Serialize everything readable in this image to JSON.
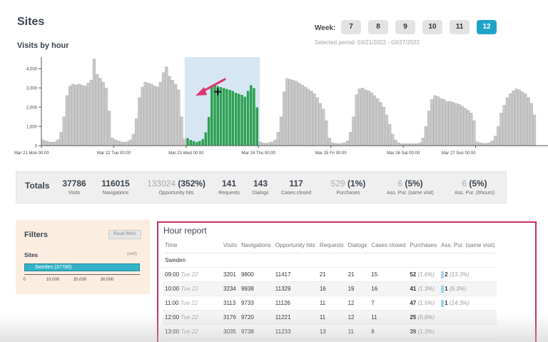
{
  "page": {
    "title": "Sites"
  },
  "week_selector": {
    "label": "Week:",
    "weeks": [
      "7",
      "8",
      "9",
      "10",
      "11",
      "12"
    ],
    "active": "12",
    "selected_period": "Selected period: 03/21/2022 - 03/27/2022"
  },
  "chart_data": {
    "type": "bar",
    "title": "Visits by hour",
    "yticks": [
      "0",
      "1,000",
      "2,000",
      "3,000",
      "4,000"
    ],
    "ylim": [
      0,
      4600
    ],
    "xticks": [
      "Mar 21 Mon 00:00",
      "Mar 22 Tue 00:00",
      "Mar 23 Wed 00:00",
      "Mar 24 Thu 00:00",
      "Mar 25 Fri 00:00",
      "Mar 26 Sat 00:00",
      "Mar 27 Sun 00:00"
    ],
    "hours_per_bar": 1,
    "selected_range_hours": [
      48,
      72
    ],
    "colors": {
      "bar": "#c8c8c8",
      "bar_stroke": "#9a9a9a",
      "selected": "#2da055",
      "selection_bg": "#d7e6f3"
    },
    "values": [
      300,
      250,
      200,
      180,
      200,
      300,
      700,
      1500,
      2600,
      3100,
      3200,
      3150,
      3200,
      3150,
      3100,
      3250,
      3400,
      4500,
      3700,
      3500,
      3300,
      3000,
      1800,
      400,
      300,
      250,
      200,
      180,
      200,
      300,
      600,
      1400,
      2500,
      3050,
      3300,
      3250,
      3200,
      3100,
      3050,
      3300,
      3800,
      4100,
      3600,
      3400,
      3200,
      2900,
      1500,
      350,
      400,
      300,
      250,
      200,
      250,
      350,
      700,
      1500,
      3050,
      3150,
      3100,
      3050,
      3000,
      2950,
      2900,
      2850,
      2750,
      2700,
      2650,
      2550,
      2850,
      3150,
      3000,
      2000,
      200,
      150,
      120,
      150,
      200,
      300,
      700,
      1500,
      2800,
      3500,
      3450,
      3400,
      3350,
      3250,
      3150,
      3050,
      2950,
      2850,
      2700,
      2500,
      2200,
      1900,
      1300,
      400,
      150,
      120,
      100,
      120,
      150,
      250,
      700,
      1500,
      2650,
      2950,
      3000,
      2900,
      2850,
      2750,
      2600,
      2450,
      2250,
      2000,
      1600,
      1100,
      600,
      300,
      150,
      100,
      100,
      100,
      100,
      100,
      100,
      150,
      400,
      1000,
      1800,
      2400,
      2600,
      2550,
      2450,
      2400,
      2300,
      2300,
      2250,
      2200,
      2150,
      2050,
      1950,
      1850,
      1700,
      1300,
      200,
      150,
      120,
      120,
      150,
      250,
      500,
      1000,
      1700,
      2100,
      2500,
      2700,
      2850,
      2950,
      2900,
      2800,
      2700,
      2500,
      2200,
      1600,
      0,
      0,
      0,
      0
    ]
  },
  "totals": {
    "title": "Totals",
    "items": [
      {
        "value": "37786",
        "label": "Visits"
      },
      {
        "value": "116015",
        "label": "Navigations"
      },
      {
        "value": "133024",
        "extra": "(352%)",
        "label": "Opportunity hits"
      },
      {
        "value": "141",
        "label": "Requests"
      },
      {
        "value": "143",
        "label": "Dialogs"
      },
      {
        "value": "117",
        "label": "Cases closed"
      },
      {
        "value": "529",
        "extra": "(1%)",
        "label": "Purchases"
      },
      {
        "value": "6",
        "extra": "(5%)",
        "label": "Ass. Pur. (same visit)"
      },
      {
        "value": "6",
        "extra": "(5%)",
        "label": "Ass. Pur. (6hours)"
      }
    ]
  },
  "filters": {
    "title": "Filters",
    "reset_label": "Reset filters",
    "sites_label": "Sites",
    "sort_label": "(sort)",
    "site": "Sweden (37786)",
    "site_fraction": 1.0,
    "axis_ticks": [
      "0",
      "10,000",
      "20,000",
      "30,000"
    ]
  },
  "report": {
    "title": "Hour report",
    "columns": [
      "Time",
      "Visits",
      "Navigations",
      "Opportunity hits",
      "Requests",
      "Dialogs",
      "Cases closed",
      "Purchases",
      "Ass. Pur. (same visit)"
    ],
    "group": "Sweden",
    "rows": [
      {
        "time": "09:00",
        "day": "Tue 22",
        "visits": "3201",
        "navigations": "9800",
        "opp": "11417",
        "requests": "21",
        "dialogs": "21",
        "cases": "15",
        "purchases": "52",
        "purchases_pct": "(1.6%)",
        "ass": "2",
        "ass_pct": "(13.3%)"
      },
      {
        "time": "10:00",
        "day": "Tue 22",
        "visits": "3234",
        "navigations": "9938",
        "opp": "11329",
        "requests": "16",
        "dialogs": "19",
        "cases": "16",
        "purchases": "41",
        "purchases_pct": "(1.3%)",
        "ass": "1",
        "ass_pct": "(6.3%)"
      },
      {
        "time": "11:00",
        "day": "Tue 22",
        "visits": "3113",
        "navigations": "9733",
        "opp": "11126",
        "requests": "11",
        "dialogs": "12",
        "cases": "7",
        "purchases": "47",
        "purchases_pct": "(1.5%)",
        "ass": "1",
        "ass_pct": "(14.3%)"
      },
      {
        "time": "12:00",
        "day": "Tue 22",
        "visits": "3176",
        "navigations": "9720",
        "opp": "11221",
        "requests": "11",
        "dialogs": "12",
        "cases": "11",
        "purchases": "25",
        "purchases_pct": "(0.8%)",
        "ass": "",
        "ass_pct": ""
      },
      {
        "time": "13:00",
        "day": "Tue 22",
        "visits": "3035",
        "navigations": "9738",
        "opp": "11233",
        "requests": "13",
        "dialogs": "11",
        "cases": "8",
        "purchases": "39",
        "purchases_pct": "(1.3%)",
        "ass": "",
        "ass_pct": ""
      }
    ]
  }
}
